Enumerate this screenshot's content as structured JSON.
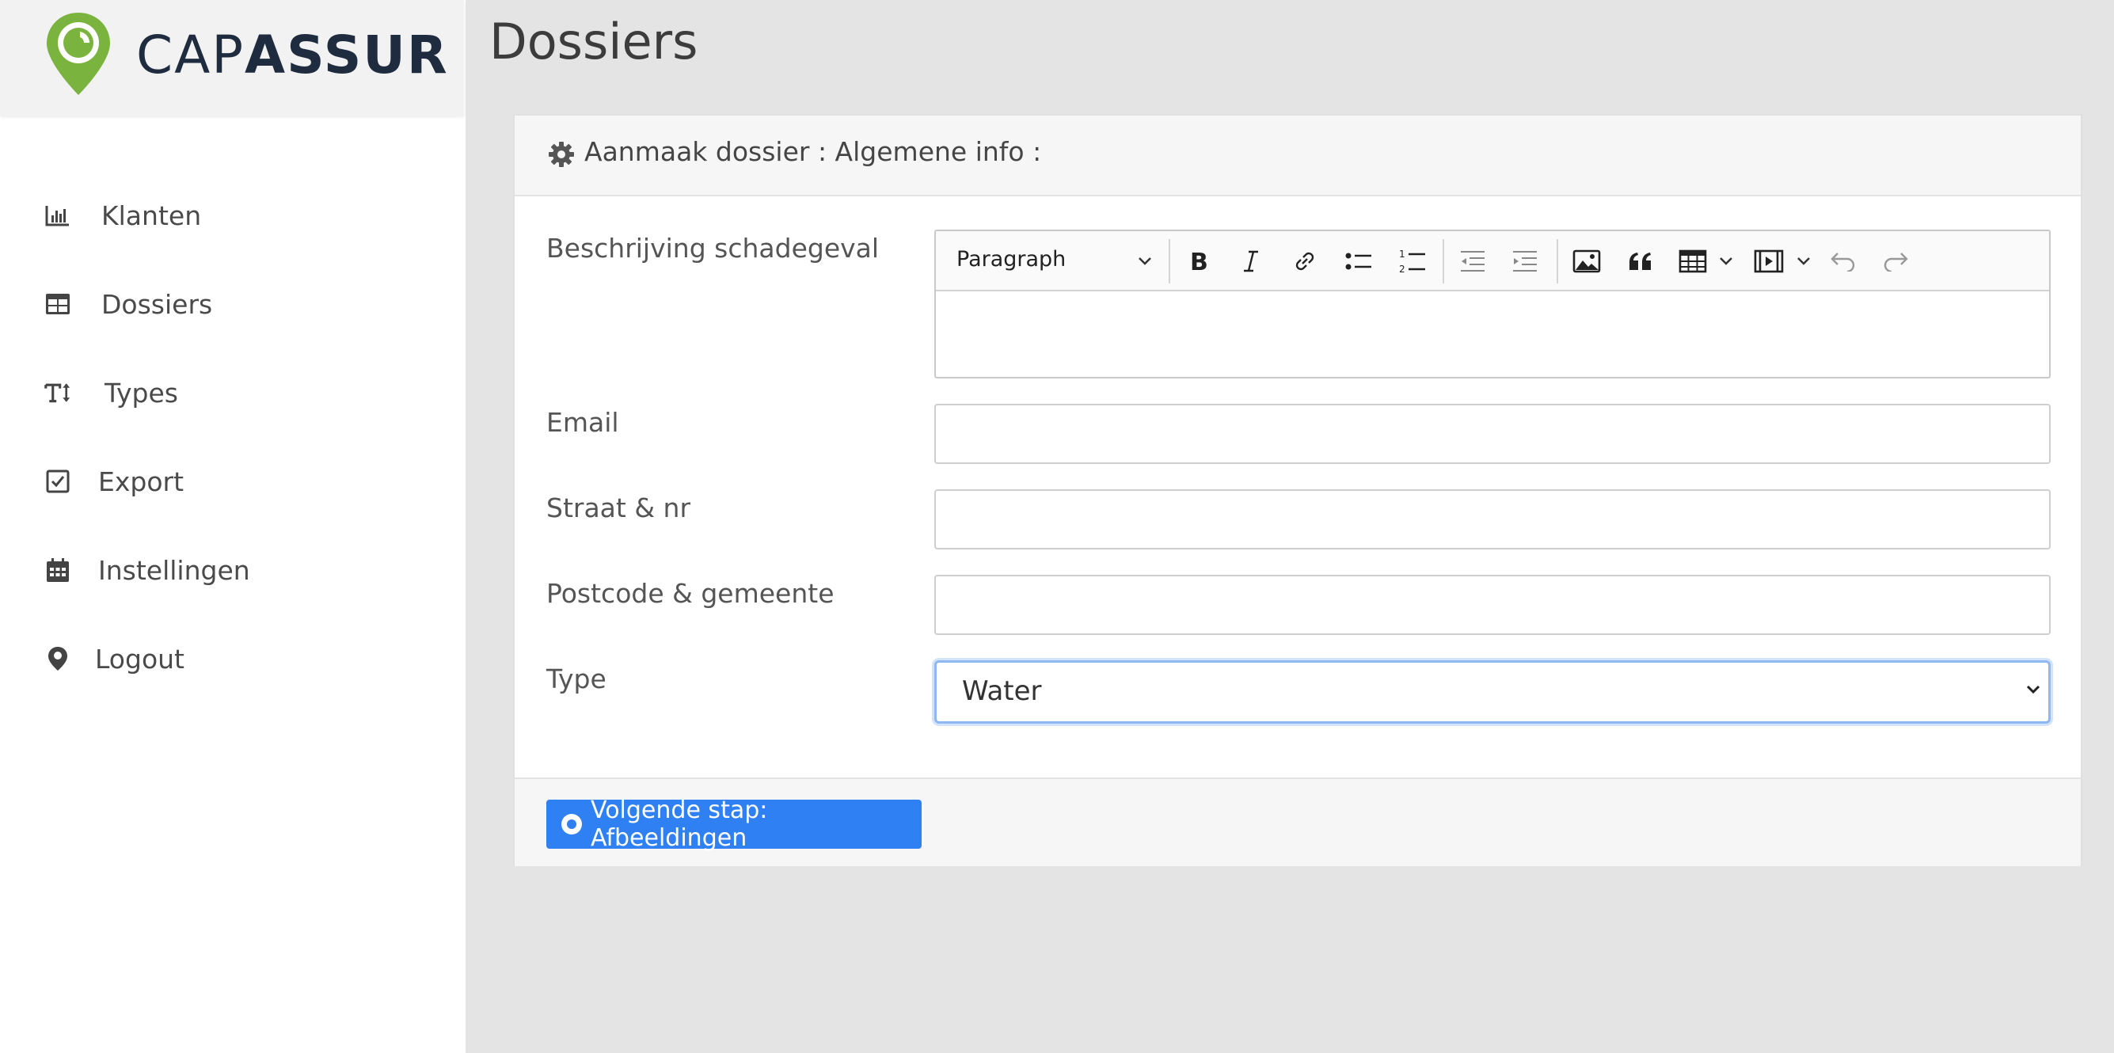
{
  "brand": {
    "cap": "CAP",
    "assur": "ASSUR",
    "pin_color": "#7ab33e"
  },
  "sidebar": {
    "items": [
      {
        "label": "Klanten",
        "icon": "bar-chart-icon"
      },
      {
        "label": "Dossiers",
        "icon": "table-icon"
      },
      {
        "label": "Types",
        "icon": "text-height-icon"
      },
      {
        "label": "Export",
        "icon": "check-square-icon"
      },
      {
        "label": "Instellingen",
        "icon": "calendar-icon"
      },
      {
        "label": "Logout",
        "icon": "map-marker-icon"
      }
    ]
  },
  "page": {
    "title": "Dossiers"
  },
  "card": {
    "header_title": "Aanmaak dossier : Algemene info :",
    "fields": {
      "description_label": "Beschrijving schadegeval",
      "email_label": "Email",
      "email_value": "",
      "street_label": "Straat & nr",
      "street_value": "",
      "postcode_label": "Postcode & gemeente",
      "postcode_value": "",
      "type_label": "Type",
      "type_value": "Water"
    },
    "editor": {
      "paragraph_label": "Paragraph",
      "toolbar_icons": [
        "bold-icon",
        "italic-icon",
        "link-icon",
        "bulleted-list-icon",
        "numbered-list-icon",
        "outdent-icon",
        "indent-icon",
        "image-icon",
        "quote-icon",
        "table-icon",
        "media-icon",
        "undo-icon",
        "redo-icon"
      ]
    },
    "next_button": "Volgende stap: Afbeeldingen"
  },
  "colors": {
    "accent": "#2f80f2",
    "sidebar_bg": "#ffffff",
    "content_bg": "#e4e4e4"
  }
}
